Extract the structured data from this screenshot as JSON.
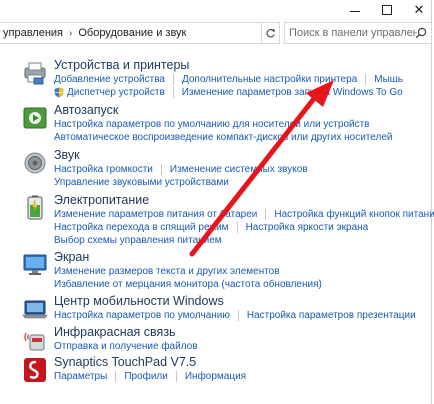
{
  "window": {
    "minimize_glyph": "—",
    "maximize_glyph": "□",
    "close_glyph": "✕"
  },
  "address": {
    "crumbs": [
      "управления",
      "Оборудование и звук"
    ],
    "separator": "›",
    "dropdown_glyph": "⌄",
    "refresh_glyph": "↻",
    "search_placeholder": "Поиск в панели управления",
    "search_icon": "magnifier-icon"
  },
  "categories": [
    {
      "id": "devices",
      "icon": "printer-icon",
      "title": "Устройства и принтеры",
      "rows": [
        [
          "Добавление устройства",
          "Дополнительные настройки принтера",
          "Мышь"
        ],
        [
          "Диспетчер устройств",
          "Изменение параметров запуска Windows To Go"
        ]
      ]
    },
    {
      "id": "autoplay",
      "icon": "autoplay-icon",
      "title": "Автозапуск",
      "rows": [
        [
          "Настройка параметров по умолчанию для носителей или устройств"
        ],
        [
          "Автоматическое воспроизведение компакт-дисков или других носителей"
        ]
      ]
    },
    {
      "id": "sound",
      "icon": "speaker-icon",
      "title": "Звук",
      "rows": [
        [
          "Настройка громкости",
          "Изменение системных звуков"
        ],
        [
          "Управление звуковыми устройствами"
        ]
      ]
    },
    {
      "id": "power",
      "icon": "battery-icon",
      "title": "Электропитание",
      "rows": [
        [
          "Изменение параметров питания от батареи",
          "Настройка функций кнопок питания"
        ],
        [
          "Настройка перехода в спящий режим",
          "Настройка яркости экрана"
        ],
        [
          "Выбор схемы управления питанием"
        ]
      ]
    },
    {
      "id": "display",
      "icon": "monitor-icon",
      "title": "Экран",
      "rows": [
        [
          "Изменение размеров текста и других элементов"
        ],
        [
          "Избавление от мерцания монитора (частота обновления)"
        ]
      ]
    },
    {
      "id": "mobility",
      "icon": "mobility-center-icon",
      "title": "Центр мобильности Windows",
      "rows": [
        [
          "Настройка параметров по умолчанию",
          "Настройка параметров презентации"
        ]
      ]
    },
    {
      "id": "infrared",
      "icon": "infrared-icon",
      "title": "Инфракрасная связь",
      "rows": [
        [
          "Отправка и получение файлов"
        ]
      ]
    },
    {
      "id": "touchpad",
      "icon": "synaptics-icon",
      "title": "Synaptics TouchPad V7.5",
      "rows": [
        [
          "Параметры",
          "Профили",
          "Информация"
        ]
      ]
    }
  ],
  "colors": {
    "link": "#1a5bb6",
    "title": "#1e395b",
    "arrow": "#e8141b"
  }
}
